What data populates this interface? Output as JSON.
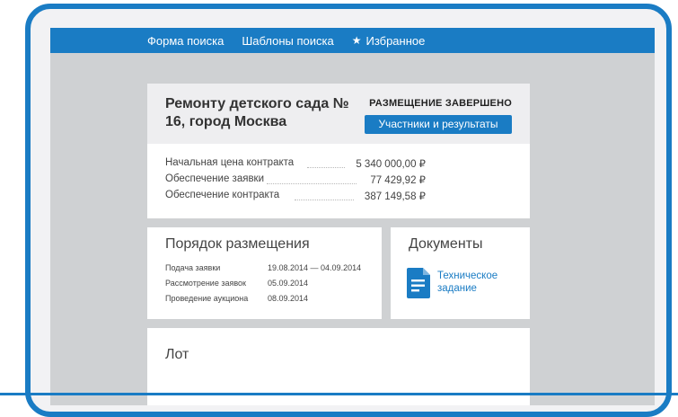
{
  "nav": {
    "items": [
      {
        "label": "Форма поиска"
      },
      {
        "label": "Шаблоны поиска"
      },
      {
        "label": "Избранное",
        "icon": "star-icon"
      }
    ]
  },
  "contract": {
    "title": "Ремонту детского сада № 16, город Москва",
    "status": "РАЗМЕЩЕНИЕ ЗАВЕРШЕНО",
    "results_button": "Участники и результаты",
    "details": [
      {
        "label": "Начальная цена контракта",
        "value": "5 340 000,00 ₽"
      },
      {
        "label": "Обеспечение заявки",
        "value": "77 429,92 ₽"
      },
      {
        "label": "Обеспечение контракта",
        "value": "387 149,58 ₽"
      }
    ]
  },
  "procedure": {
    "title": "Порядок размещения",
    "rows": [
      {
        "label": "Подача заявки",
        "value": "19.08.2014 — 04.09.2014"
      },
      {
        "label": "Рассмотрение заявок",
        "value": "05.09.2014"
      },
      {
        "label": "Проведение аукциона",
        "value": "08.09.2014"
      }
    ]
  },
  "documents": {
    "title": "Документы",
    "items": [
      {
        "line1": "Техническое",
        "line2": "задание",
        "icon": "document-icon"
      }
    ]
  },
  "lot": {
    "title": "Лот"
  },
  "colors": {
    "accent": "#1a7cc4",
    "background": "#cfd1d3",
    "card_header": "#eeeef0"
  }
}
